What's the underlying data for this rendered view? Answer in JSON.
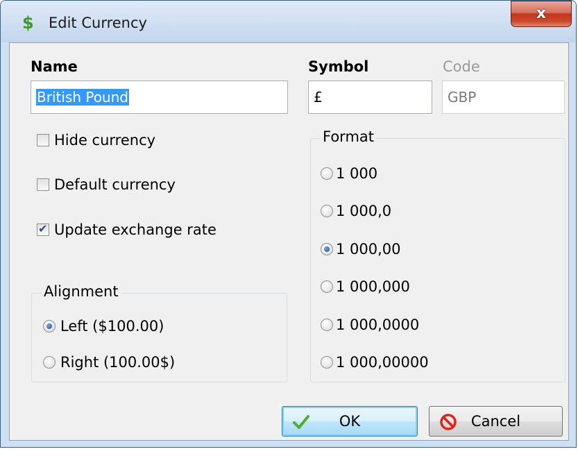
{
  "window": {
    "title": "Edit Currency",
    "close_label": "x"
  },
  "fields": {
    "name_label": "Name",
    "name_value": "British Pound",
    "symbol_label": "Symbol",
    "symbol_value": "£",
    "code_label": "Code",
    "code_value": "GBP"
  },
  "options": {
    "hide_currency": {
      "label": "Hide currency",
      "checked": false
    },
    "default_currency": {
      "label": "Default currency",
      "checked": false
    },
    "update_rate": {
      "label": "Update exchange rate",
      "checked": true
    }
  },
  "alignment": {
    "title": "Alignment",
    "items": [
      {
        "label": "Left ($100.00)",
        "checked": true
      },
      {
        "label": "Right (100.00$)",
        "checked": false
      }
    ]
  },
  "format": {
    "title": "Format",
    "items": [
      {
        "label": "1 000",
        "checked": false
      },
      {
        "label": "1 000,0",
        "checked": false
      },
      {
        "label": "1 000,00",
        "checked": true
      },
      {
        "label": "1 000,000",
        "checked": false
      },
      {
        "label": "1 000,0000",
        "checked": false
      },
      {
        "label": "1 000,00000",
        "checked": false
      }
    ]
  },
  "buttons": {
    "ok_label": "OK",
    "cancel_label": "Cancel"
  },
  "colors": {
    "selection": "#3399ff",
    "titlebar": "#c3d6ee",
    "ok_icon": "#4caf2a",
    "cancel_icon": "#d9261c"
  }
}
